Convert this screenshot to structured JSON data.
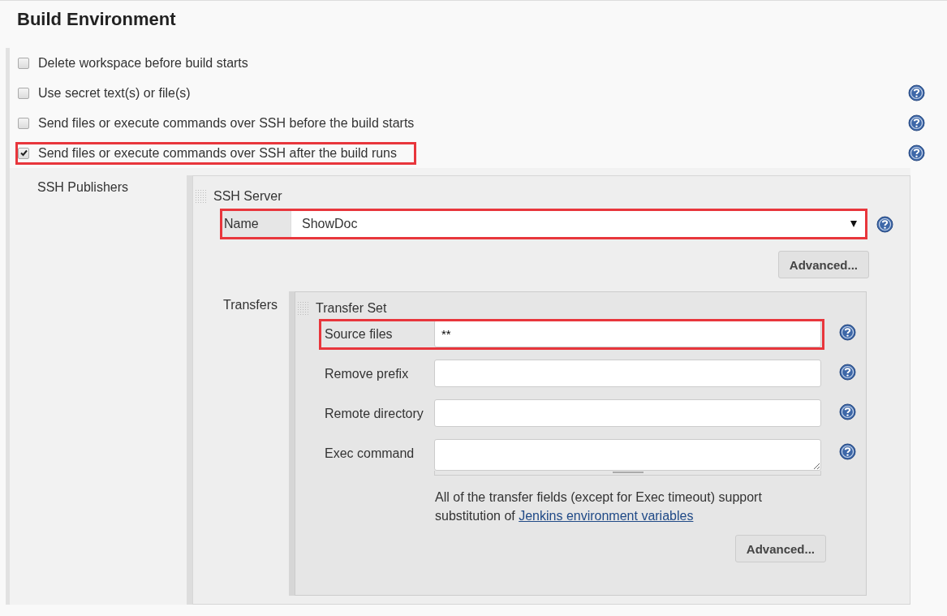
{
  "title": "Build Environment",
  "options": [
    {
      "label": "Delete workspace before build starts",
      "checked": false,
      "help": false,
      "highlighted": false
    },
    {
      "label": "Use secret text(s) or file(s)",
      "checked": false,
      "help": true,
      "highlighted": false
    },
    {
      "label": "Send files or execute commands over SSH before the build starts",
      "checked": false,
      "help": true,
      "highlighted": false
    },
    {
      "label": "Send files or execute commands over SSH after the build runs",
      "checked": true,
      "help": true,
      "highlighted": true
    }
  ],
  "ssh_publishers": {
    "label": "SSH Publishers",
    "server": {
      "title": "SSH Server",
      "name_label": "Name",
      "name_value": "ShowDoc",
      "name_highlighted": true,
      "advanced_button": "Advanced...",
      "transfers_label": "Transfers",
      "transfer_set": {
        "title": "Transfer Set",
        "fields": [
          {
            "kind": "input",
            "label": "Source files",
            "value": "**",
            "highlighted": true
          },
          {
            "kind": "input",
            "label": "Remove prefix",
            "highlighted": false
          },
          {
            "kind": "input",
            "label": "Remote directory",
            "highlighted": false
          },
          {
            "kind": "textarea",
            "label": "Exec command",
            "highlighted": false
          }
        ],
        "note": "All of the transfer fields (except for Exec timeout) support substitution of",
        "note_link": "Jenkins environment variables",
        "advanced_button": "Advanced..."
      }
    }
  }
}
